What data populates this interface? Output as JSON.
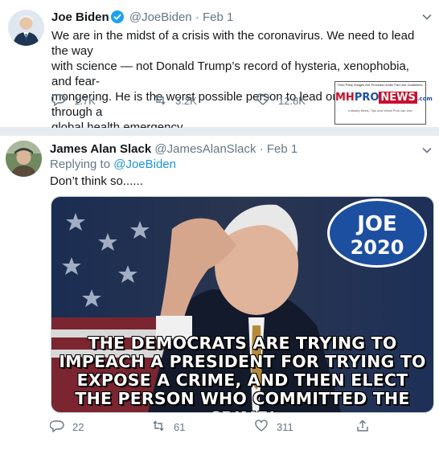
{
  "tweets": [
    {
      "name": "Joe Biden",
      "handle": "@JoeBiden",
      "dot": "·",
      "date": "Feb 1",
      "text_lines": [
        "We are in the midst of a crisis with the coronavirus. We need to lead the way",
        "with science — not Donald Trump’s record of hysteria, xenophobia, and fear-",
        "mongering. He is the worst possible person to lead our country through a",
        "global health emergency."
      ],
      "replies": "1.7K",
      "retweets": "3.2K",
      "likes": "12.8K"
    },
    {
      "name": "James Alan Slack",
      "handle": "@JamesAlanSlack",
      "dot": "·",
      "date": "Feb 1",
      "replying_prefix": "Replying to ",
      "replying_to": "@JoeBiden",
      "text": "Don’t think so......",
      "media": {
        "badge_line1": "JOE",
        "badge_line2": "2020",
        "caption_lines": [
          "THE DEMOCRATS ARE TRYING TO",
          "IMPEACH A PRESIDENT FOR TRYING TO",
          "EXPOSE A CRIME, AND THEN ELECT",
          "THE PERSON WHO COMMITTED THE CRIME!"
        ]
      },
      "replies": "22",
      "retweets": "61",
      "likes": "311"
    }
  ],
  "watermark": {
    "top_text": "Third Party Images Are Provided Under Fair Use Guidelines.",
    "logo_mh": "MH",
    "logo_pro": "PRO",
    "logo_news": "NEWS",
    "logo_suffix": ".com",
    "tagline": "Industry News, Tips and Views Pros can Use"
  },
  "colors": {
    "verified": "#1da1f2",
    "link": "#1b95e0",
    "muted": "#657786",
    "badge_blue": "#1d4fa0",
    "badge_red": "#c8102e"
  },
  "icons": {
    "reply": "reply-icon",
    "retweet": "retweet-icon",
    "like": "heart-icon",
    "share": "share-icon",
    "menu": "chevron-down-icon",
    "verified": "verified-badge-icon"
  }
}
